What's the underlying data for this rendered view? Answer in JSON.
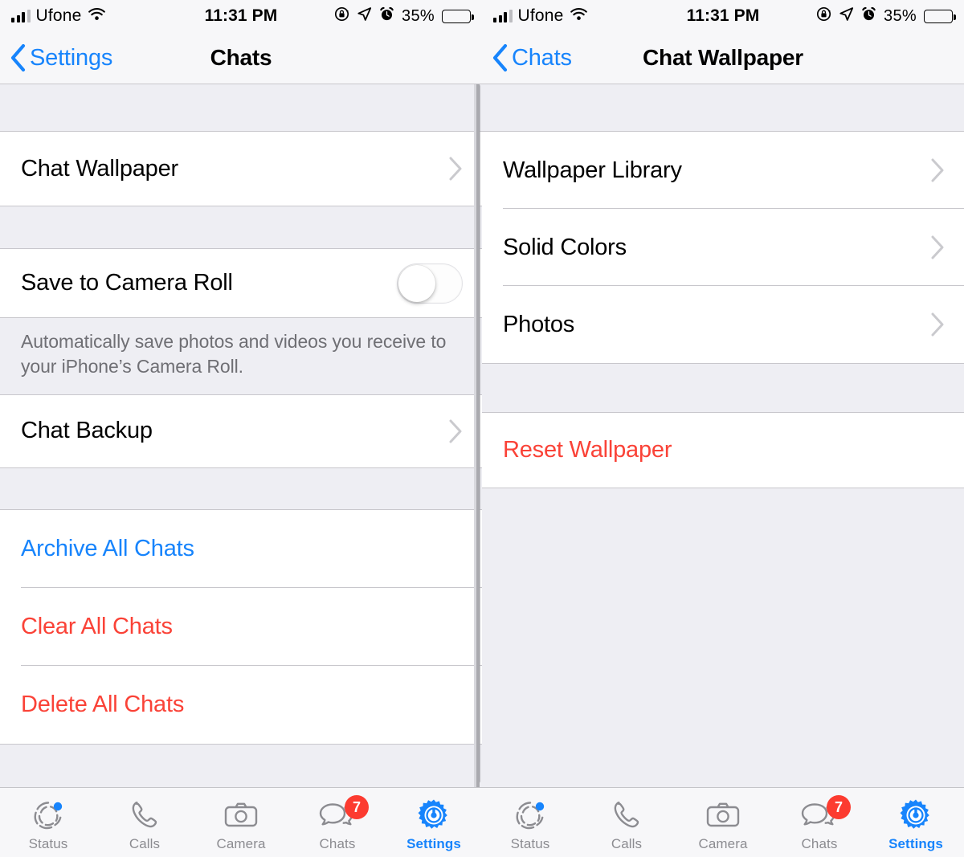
{
  "status_bar": {
    "carrier": "Ufone",
    "time": "11:31 PM",
    "battery_percent": "35%",
    "icons": [
      "signal-bars-icon",
      "wifi-icon",
      "rotation-lock-icon",
      "location-arrow-icon",
      "alarm-clock-icon",
      "battery-icon"
    ]
  },
  "left_panel": {
    "nav": {
      "back_label": "Settings",
      "title": "Chats"
    },
    "groups": [
      {
        "rows": [
          {
            "label": "Chat Wallpaper",
            "type": "disclosure",
            "style": "default"
          }
        ]
      },
      {
        "rows": [
          {
            "label": "Save to Camera Roll",
            "type": "toggle",
            "style": "default",
            "toggle_on": false
          }
        ],
        "footnote": "Automatically save photos and videos you receive to your iPhone’s Camera Roll."
      },
      {
        "rows": [
          {
            "label": "Chat Backup",
            "type": "disclosure",
            "style": "default"
          }
        ]
      },
      {
        "rows": [
          {
            "label": "Archive All Chats",
            "type": "plain",
            "style": "link"
          },
          {
            "label": "Clear All Chats",
            "type": "plain",
            "style": "danger"
          },
          {
            "label": "Delete All Chats",
            "type": "plain",
            "style": "danger"
          }
        ]
      }
    ]
  },
  "right_panel": {
    "nav": {
      "back_label": "Chats",
      "title": "Chat Wallpaper"
    },
    "groups": [
      {
        "rows": [
          {
            "label": "Wallpaper Library",
            "type": "disclosure",
            "style": "default"
          },
          {
            "label": "Solid Colors",
            "type": "disclosure",
            "style": "default"
          },
          {
            "label": "Photos",
            "type": "disclosure",
            "style": "default"
          }
        ]
      },
      {
        "rows": [
          {
            "label": "Reset Wallpaper",
            "type": "plain",
            "style": "danger"
          }
        ]
      }
    ]
  },
  "tab_bar": {
    "tabs": [
      {
        "label": "Status",
        "icon": "status-rings-icon",
        "active": false,
        "dot": true,
        "badge": null
      },
      {
        "label": "Calls",
        "icon": "phone-icon",
        "active": false,
        "dot": false,
        "badge": null
      },
      {
        "label": "Camera",
        "icon": "camera-icon",
        "active": false,
        "dot": false,
        "badge": null
      },
      {
        "label": "Chats",
        "icon": "chat-bubbles-icon",
        "active": false,
        "dot": false,
        "badge": "7"
      },
      {
        "label": "Settings",
        "icon": "gear-icon",
        "active": true,
        "dot": false,
        "badge": null
      }
    ]
  },
  "colors": {
    "accent_blue": "#1784fc",
    "danger_red": "#fa4237",
    "badge_red": "#fc3b30",
    "group_bg": "#eeeef3",
    "chrome_bg": "#f7f7f9",
    "separator": "#c8c7cc",
    "secondary_text": "#6f6f74"
  }
}
